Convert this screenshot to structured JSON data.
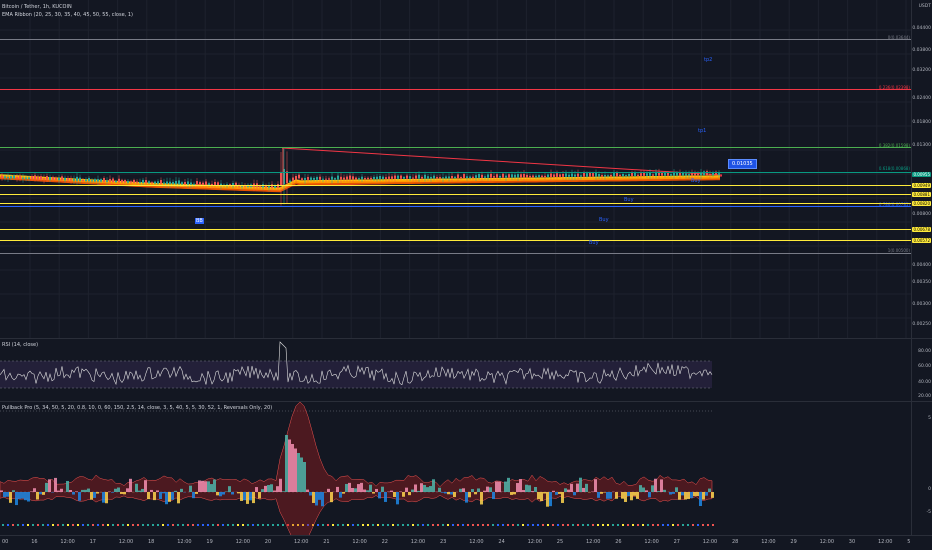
{
  "header": {
    "symbol_line": "Bitcoin / Tether, 1h, KUCOIN",
    "indicator_line": "EMA Ribbon (20, 25, 30, 35, 40, 45, 50, 55, close, 1)"
  },
  "price_axis": {
    "currency": "USDT",
    "labels": [
      "0.04400",
      "0.03800",
      "0.03200",
      "0.02400",
      "0.01800",
      "0.01300",
      "0.00800",
      "0.00700",
      "0.00600",
      "0.00500",
      "0.00400",
      "0.00350",
      "0.00300",
      "0.00250"
    ]
  },
  "fib_levels": [
    {
      "label": "0(0.03644)",
      "color": "#787b86"
    },
    {
      "label": "0.236(0.02398)",
      "color": "#f23645"
    },
    {
      "label": "0.382(0.01598)",
      "color": "#4caf50"
    },
    {
      "label": "0.618(0.00868)",
      "color": "#089981"
    },
    {
      "label": "0.786(0.00785)",
      "color": "#2962ff"
    },
    {
      "label": "1(0.00500)",
      "color": "#787b86"
    }
  ],
  "price_tags": {
    "current": "0.00955",
    "highlighted": [
      "0.00949",
      "0.00881",
      "0.00820",
      "0.00678",
      "0.00572"
    ],
    "callout": "0.01035"
  },
  "signals": {
    "tp2": "tp2",
    "tp1": "tp1",
    "buy_labels": [
      "Buy",
      "Buy",
      "Buy",
      "Buy"
    ],
    "sell": "BB"
  },
  "rsi": {
    "legend": "RSI (14, close)",
    "axis_labels": [
      "80.00",
      "60.00",
      "40.00",
      "20.00"
    ]
  },
  "oscillator": {
    "legend": "Pullback Pro (5, 34, 50, 5, 20, 0.8, 10, 0, 60, 150, 2.5, 14, close, 3, 5, 40, 5, 5, 30, 52, 1, Reversals Only, 20)",
    "axis_labels": [
      "5",
      "0",
      "-5"
    ]
  },
  "time_axis": {
    "labels": [
      "00",
      "16",
      "12:00",
      "17",
      "12:00",
      "18",
      "12:00",
      "19",
      "12:00",
      "20",
      "12:00",
      "21",
      "12:00",
      "22",
      "12:00",
      "23",
      "12:00",
      "24",
      "12:00",
      "25",
      "12:00",
      "26",
      "12:00",
      "27",
      "12:00",
      "28",
      "12:00",
      "29",
      "12:00",
      "30",
      "12:00",
      "5"
    ]
  },
  "colors": {
    "background": "#131722",
    "grid": "#1e222d",
    "ribbon": "#ff9800",
    "yellow_band": "#ffeb3b",
    "trend_line": "#f23645",
    "rsi_band": "#7e57c2"
  }
}
